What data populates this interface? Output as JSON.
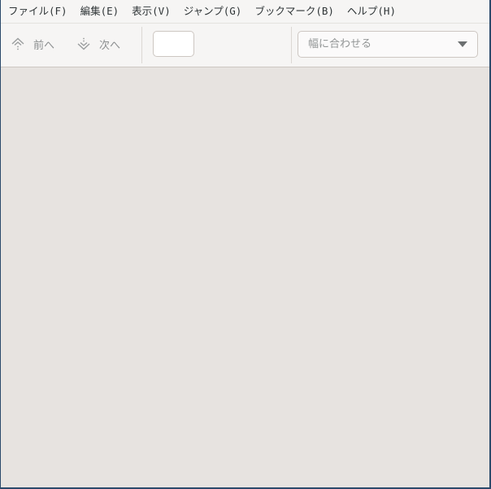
{
  "menubar": {
    "items": [
      {
        "label": "ファイル(F)"
      },
      {
        "label": "編集(E)"
      },
      {
        "label": "表示(V)"
      },
      {
        "label": "ジャンプ(G)"
      },
      {
        "label": "ブックマーク(B)"
      },
      {
        "label": "ヘルプ(H)"
      }
    ]
  },
  "toolbar": {
    "prev_label": "前へ",
    "next_label": "次へ",
    "page_entry_value": "",
    "zoom_selected": "幅に合わせる"
  },
  "icons": {
    "prev": "go-up-icon",
    "next": "go-down-icon",
    "zoom_dropdown": "chevron-down-icon"
  }
}
